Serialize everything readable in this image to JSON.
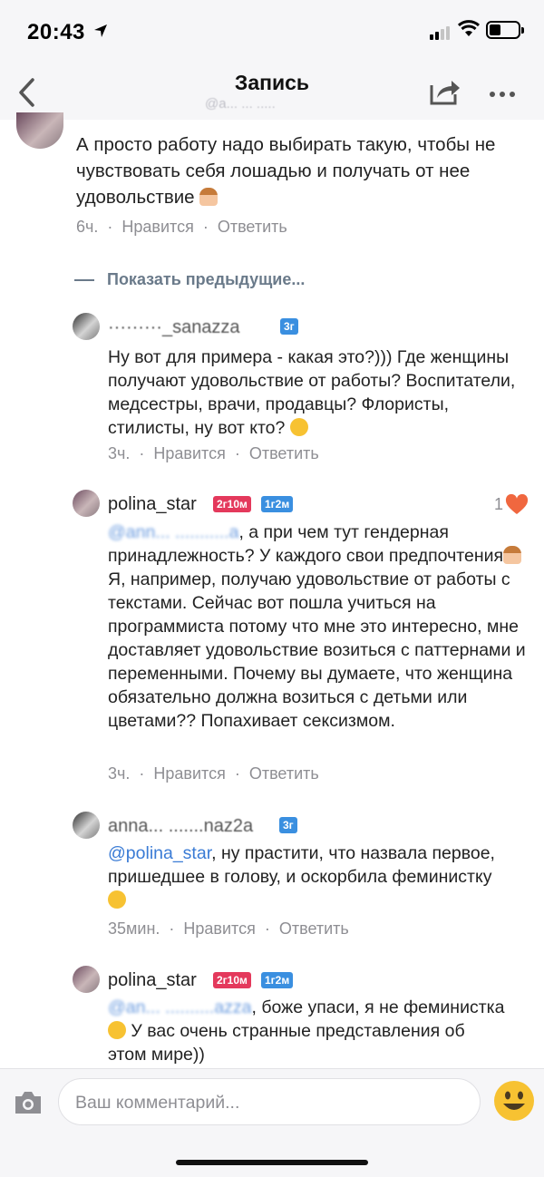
{
  "status": {
    "time": "20:43"
  },
  "header": {
    "title": "Запись",
    "sub_blurred": "@a... ... ....."
  },
  "comments": [
    {
      "username": "polina_star",
      "text": "А просто работу надо выбирать такую, чтобы не чувствовать себя лошадью и получать от нее удовольствие",
      "time": "6ч.",
      "like": "Нравится",
      "reply": "Ответить"
    },
    {
      "username": "·········_sanazza",
      "badge": "3г",
      "text": "Ну вот для примера - какая это?))) Где женщины получают удовольствие от работы? Воспитатели, медсестры, врачи, продавцы? Флористы, стилисты, ну вот кто?",
      "time": "3ч.",
      "like": "Нравится",
      "reply": "Ответить"
    },
    {
      "username": "polina_star",
      "badge1": "2г10м",
      "badge2": "1г2м",
      "likes": "1",
      "mention": "@ann... ...........a",
      "text": ", а при чем тут гендерная принадлежность? У каждого свои предпочтения",
      "text2": " Я, например, получаю удовольствие от работы с текстами. Сейчас вот пошла учиться на программиста потому что мне это интересно, мне доставляет удовольствие возиться с паттернами и переменными. Почему вы думаете, что женщина обязательно должна возиться с детьми или цветами?? Попахивает сексизмом.",
      "time": "3ч.",
      "like": "Нравится",
      "reply": "Ответить"
    },
    {
      "username": "anna... .......naz2a",
      "badge": "3г",
      "mention": "@polina_star",
      "text": ", ну прастити, что назвала первое, пришедшее в голову, и оскорбила феминистку",
      "time": "35мин.",
      "like": "Нравится",
      "reply": "Ответить"
    },
    {
      "username": "polina_star",
      "badge1": "2г10м",
      "badge2": "1г2м",
      "mention": "@an... ..........azza",
      "text": ", боже упаси, я не феминистка",
      "text2": " У вас очень странные представления об этом мире))"
    }
  ],
  "show_previous": "Показать предыдущие...",
  "input": {
    "placeholder": "Ваш комментарий..."
  },
  "colors": {
    "accent": "#3a7bd5",
    "badge_pink": "#e4395c",
    "badge_blue": "#3a8fe0",
    "heart": "#f0673f"
  }
}
